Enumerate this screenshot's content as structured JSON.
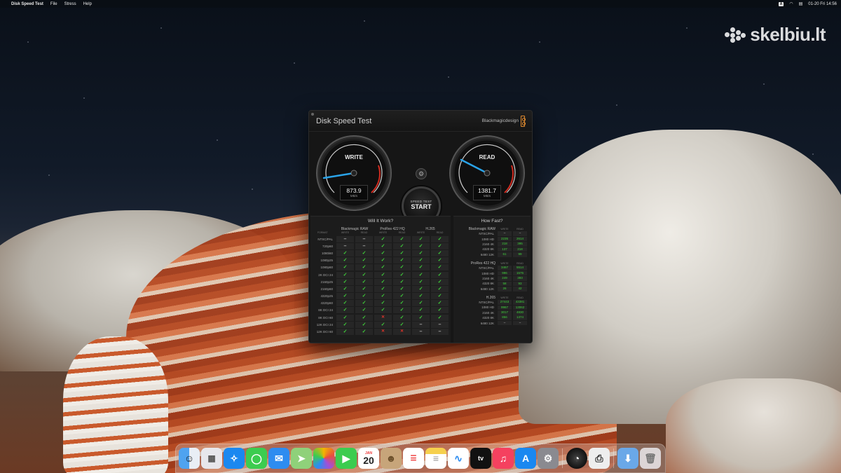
{
  "menubar": {
    "app_name": "Disk Speed Test",
    "menus": [
      "File",
      "Stress",
      "Help"
    ],
    "input_badge": "A",
    "clock": "01-20 Fri 14:56"
  },
  "watermark": {
    "text": "skelbiu.lt"
  },
  "window": {
    "title": "Disk Speed Test",
    "brand": "Blackmagicdesign",
    "write_gauge": {
      "label": "WRITE",
      "value": "873.9",
      "unit": "MB/s"
    },
    "read_gauge": {
      "label": "READ",
      "value": "1381.7",
      "unit": "MB/s"
    },
    "start_button": {
      "line1": "SPEED TEST",
      "line2": "START"
    },
    "will_it_work": {
      "title": "Will It Work?",
      "groups": [
        "Blackmagic RAW",
        "ProRes 422 HQ",
        "H.265"
      ],
      "subheaders": {
        "format": "FORMAT",
        "write": "WRITE",
        "read": "READ"
      },
      "rows": [
        {
          "format": "NTSC/PAL",
          "cells": [
            "–",
            "–",
            "✓",
            "✓",
            "✓",
            "✓"
          ]
        },
        {
          "format": "720p60",
          "cells": [
            "–",
            "–",
            "✓",
            "✓",
            "✓",
            "✓"
          ]
        },
        {
          "format": "1080i60",
          "cells": [
            "✓",
            "✓",
            "✓",
            "✓",
            "✓",
            "✓"
          ]
        },
        {
          "format": "1080p25",
          "cells": [
            "✓",
            "✓",
            "✓",
            "✓",
            "✓",
            "✓"
          ]
        },
        {
          "format": "1080p60",
          "cells": [
            "✓",
            "✓",
            "✓",
            "✓",
            "✓",
            "✓"
          ]
        },
        {
          "format": "2K DCI 24",
          "cells": [
            "✓",
            "✓",
            "✓",
            "✓",
            "✓",
            "✓"
          ]
        },
        {
          "format": "2160p25",
          "cells": [
            "✓",
            "✓",
            "✓",
            "✓",
            "✓",
            "✓"
          ]
        },
        {
          "format": "2160p60",
          "cells": [
            "✓",
            "✓",
            "✓",
            "✓",
            "✓",
            "✓"
          ]
        },
        {
          "format": "4320p25",
          "cells": [
            "✓",
            "✓",
            "✓",
            "✓",
            "✓",
            "✓"
          ]
        },
        {
          "format": "4320p60",
          "cells": [
            "✓",
            "✓",
            "✓",
            "✓",
            "✓",
            "✓"
          ]
        },
        {
          "format": "8K DCI 24",
          "cells": [
            "✓",
            "✓",
            "✓",
            "✓",
            "✓",
            "✓"
          ]
        },
        {
          "format": "8K DCI 60",
          "cells": [
            "✓",
            "✓",
            "✕",
            "✓",
            "✓",
            "✓"
          ]
        },
        {
          "format": "12K DCI 24",
          "cells": [
            "✓",
            "✓",
            "✓",
            "✓",
            "–",
            "–"
          ]
        },
        {
          "format": "12K DCI 60",
          "cells": [
            "✓",
            "✓",
            "✕",
            "✕",
            "–",
            "–"
          ]
        }
      ]
    },
    "how_fast": {
      "title": "How Fast?",
      "col_write": "WRITE",
      "col_read": "READ",
      "groups": [
        {
          "name": "Blackmagic RAW",
          "rows": [
            {
              "format": "NTSC/PAL",
              "write": "–",
              "read": "–"
            },
            {
              "format": "1080 HD",
              "write": "2235",
              "read": "2614"
            },
            {
              "format": "2160 4K",
              "write": "218",
              "read": "395"
            },
            {
              "format": "4320 8K",
              "write": "137",
              "read": "218"
            },
            {
              "format": "6480 12K",
              "write": "61",
              "read": "99"
            }
          ]
        },
        {
          "name": "ProRes 422 HQ",
          "rows": [
            {
              "format": "NTSC/PAL",
              "write": "3467",
              "read": "5514"
            },
            {
              "format": "1080 HD",
              "write": "996",
              "read": "1575"
            },
            {
              "format": "2160 4K",
              "write": "249",
              "read": "393"
            },
            {
              "format": "4320 8K",
              "write": "58",
              "read": "93"
            },
            {
              "format": "6480 12K",
              "write": "26",
              "read": "42"
            }
          ]
        },
        {
          "name": "H.265",
          "rows": [
            {
              "format": "NTSC/PAL",
              "write": "27443",
              "read": "43381"
            },
            {
              "format": "1080 HD",
              "write": "9967",
              "read": "13062"
            },
            {
              "format": "2160 4K",
              "write": "3017",
              "read": "4830"
            },
            {
              "format": "4320 8K",
              "write": "856",
              "read": "1374"
            },
            {
              "format": "6480 12K",
              "write": "–",
              "read": "–"
            }
          ]
        }
      ]
    }
  },
  "dock": {
    "calendar_month": "JAN",
    "calendar_day": "20",
    "apps": [
      "finder-icon",
      "launchpad-icon",
      "safari-icon",
      "messages-icon",
      "mail-icon",
      "maps-icon",
      "photos-icon",
      "facetime-icon",
      "calendar-icon",
      "contacts-icon",
      "reminders-icon",
      "notes-icon",
      "freeform-icon",
      "tv-icon",
      "music-icon",
      "app-store-icon",
      "system-settings-icon",
      "disk-speed-test-icon",
      "preview-icon",
      "downloads-icon",
      "trash-icon"
    ]
  },
  "colors": {
    "ok": "#3fd23a",
    "fail": "#e0352b",
    "needle": "#2aa3e8",
    "brand_accent": "#e08a2e"
  }
}
